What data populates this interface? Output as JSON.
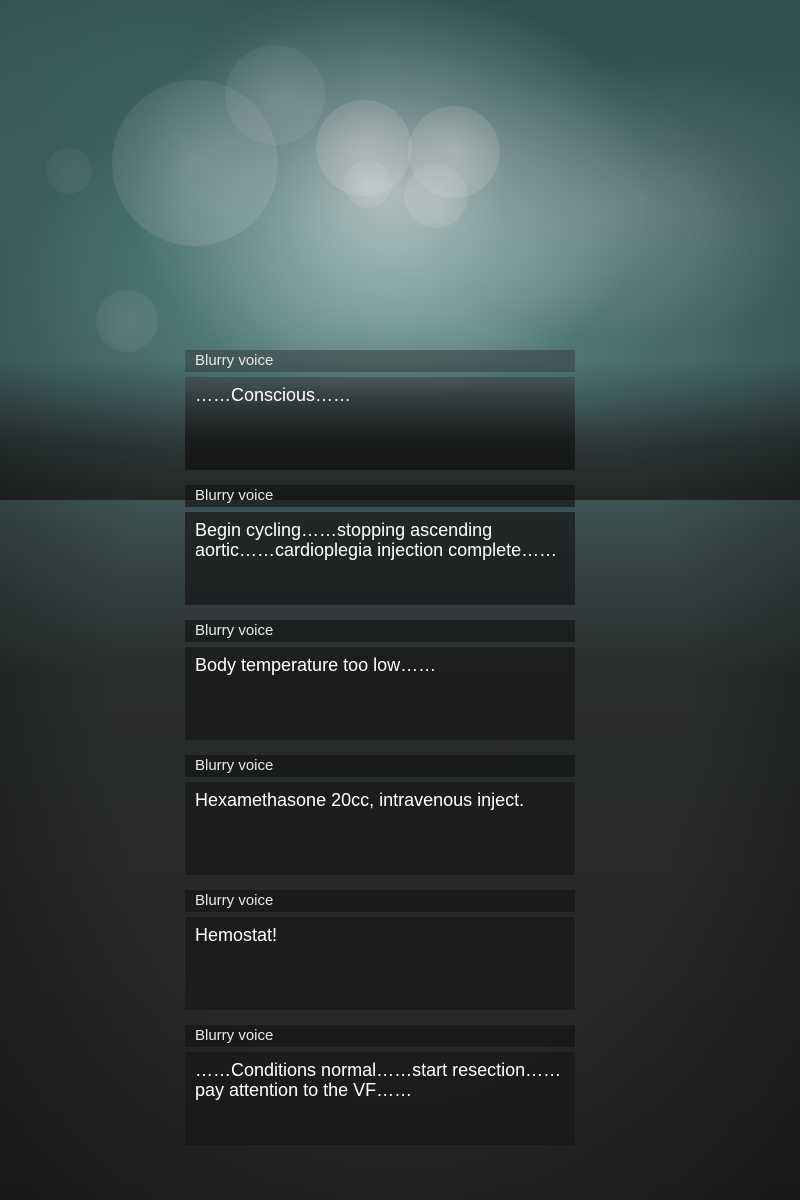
{
  "log": {
    "entries": [
      {
        "speaker": "Blurry voice",
        "text": "……Conscious……"
      },
      {
        "speaker": "Blurry voice",
        "text": "Begin cycling……stopping ascending aortic……cardioplegia injection complete……"
      },
      {
        "speaker": "Blurry voice",
        "text": "Body temperature too low……"
      },
      {
        "speaker": "Blurry voice",
        "text": "Hexamethasone 20cc, intravenous inject."
      },
      {
        "speaker": "Blurry voice",
        "text": "Hemostat!"
      },
      {
        "speaker": "Blurry voice",
        "text": "……Conditions normal……start resection……pay attention to the VF……"
      }
    ]
  }
}
